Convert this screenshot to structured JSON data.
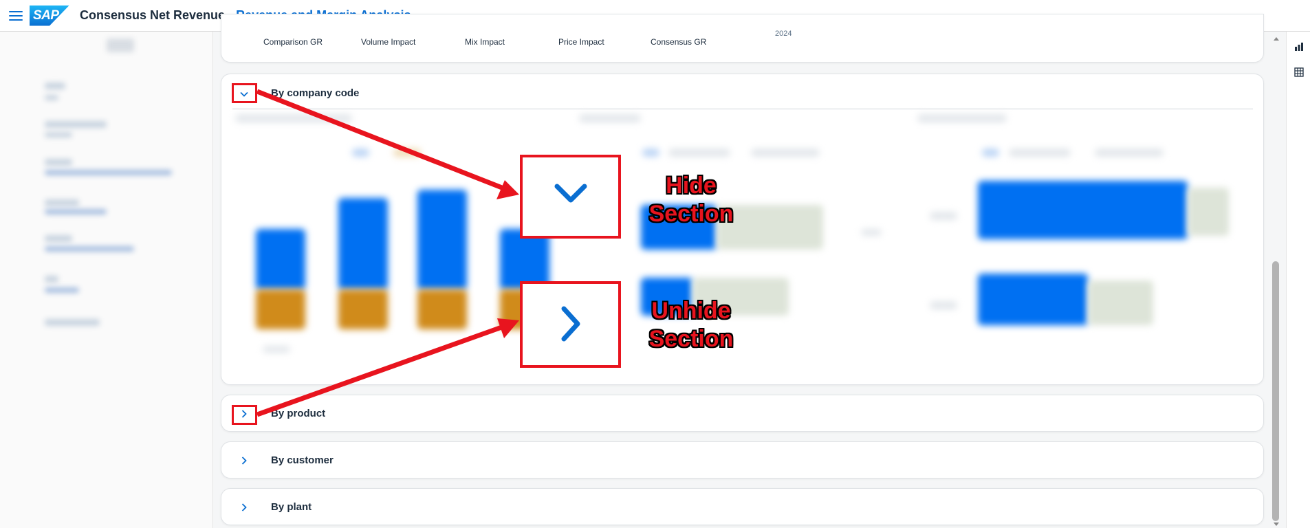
{
  "header": {
    "app_title": "Consensus Net Revenue",
    "app_subtitle": "Revenue and Margin Analysis",
    "logo_text": "SAP",
    "icon": "hamburger-menu-icon"
  },
  "top_metrics": {
    "labels": [
      "Comparison GR",
      "Volume Impact",
      "Mix Impact",
      "Price Impact",
      "Consensus GR"
    ],
    "year": "2024"
  },
  "sections": [
    {
      "title": "By company code",
      "expanded": true,
      "icon": "chevron-down-icon"
    },
    {
      "title": "By product",
      "expanded": false,
      "icon": "chevron-right-icon"
    },
    {
      "title": "By customer",
      "expanded": false,
      "icon": "chevron-right-icon"
    },
    {
      "title": "By plant",
      "expanded": false,
      "icon": "chevron-right-icon"
    }
  ],
  "annotations": {
    "hide_text_line1": "Hide",
    "hide_text_line2": "Section",
    "unhide_text_line1": "Unhide",
    "unhide_text_line2": "Section",
    "color": "#e8141e"
  },
  "right_toolbar": {
    "icons": [
      "bar-chart-icon",
      "table-icon"
    ]
  },
  "colors": {
    "accent": "#0a6ed1",
    "bar_blue": "#0070f2",
    "bar_orange": "#d08b1b"
  }
}
